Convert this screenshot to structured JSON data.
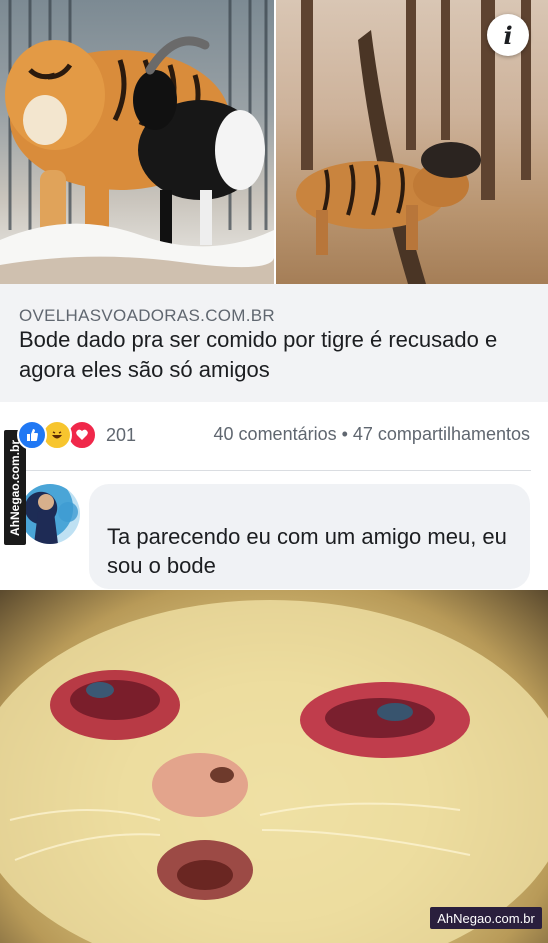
{
  "post": {
    "link": {
      "domain": "OVELHASVOADORAS.COM.BR",
      "title": "Bode dado pra ser comido por tigre é recusado e agora eles são só amigos"
    },
    "reactions": {
      "icons": [
        "like-icon",
        "haha-icon",
        "love-icon"
      ],
      "count": "201",
      "stats": "40 comentários • 47 compartilhamentos"
    },
    "comment": {
      "text": "Ta parecendo eu com um amigo meu, eu sou o bode"
    }
  },
  "watermark": {
    "side": "AhNegao.com.br",
    "bottom": "AhNegao.com.br"
  },
  "colors": {
    "like": "#2078f4",
    "haha": "#f7c52e",
    "love": "#f0284a",
    "meta_text": "#606770",
    "link_bg": "#f2f3f5",
    "bubble_bg": "#f0f2f5"
  }
}
